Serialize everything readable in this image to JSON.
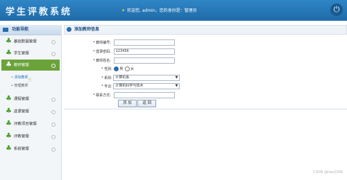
{
  "header": {
    "title": "学生评教系统",
    "welcome": "欢迎您, admin，您的身份是：管理员",
    "power_icon": "power-icon"
  },
  "sidebar": {
    "title": "功能导航",
    "items": [
      {
        "label": "基础数据管理",
        "icon": "tree-icon"
      },
      {
        "label": "学生管理",
        "icon": "tree-icon"
      },
      {
        "label": "教师管理",
        "icon": "tree-icon"
      },
      {
        "label": "课程管理",
        "icon": "tree-icon"
      },
      {
        "label": "选课管理",
        "icon": "tree-icon"
      },
      {
        "label": "评教项目管理",
        "icon": "tree-icon"
      },
      {
        "label": "评教管理",
        "icon": "tree-icon"
      },
      {
        "label": "系统管理",
        "icon": "tree-icon"
      }
    ],
    "subitems": [
      {
        "label": "添加教师"
      },
      {
        "label": "管理教师"
      }
    ]
  },
  "content": {
    "header": "添加教师信息",
    "form": {
      "teacher_no_label": "* 教师编号:",
      "teacher_no_value": "",
      "password_label": "* 登录密码:",
      "password_value": "123456",
      "name_label": "* 教师姓名:",
      "name_value": "",
      "gender_label": "* 性别:",
      "gender_male": "男",
      "gender_female": "女",
      "dept_label": "* 系别:",
      "dept_value": "计算机系",
      "major_label": "* 专业:",
      "major_value": "计算机科学与技术",
      "contact_label": "* 联系方式:",
      "contact_value": "",
      "add_button": "添 加",
      "back_button": "返 回"
    }
  },
  "watermark": "CSDN @hao2006"
}
